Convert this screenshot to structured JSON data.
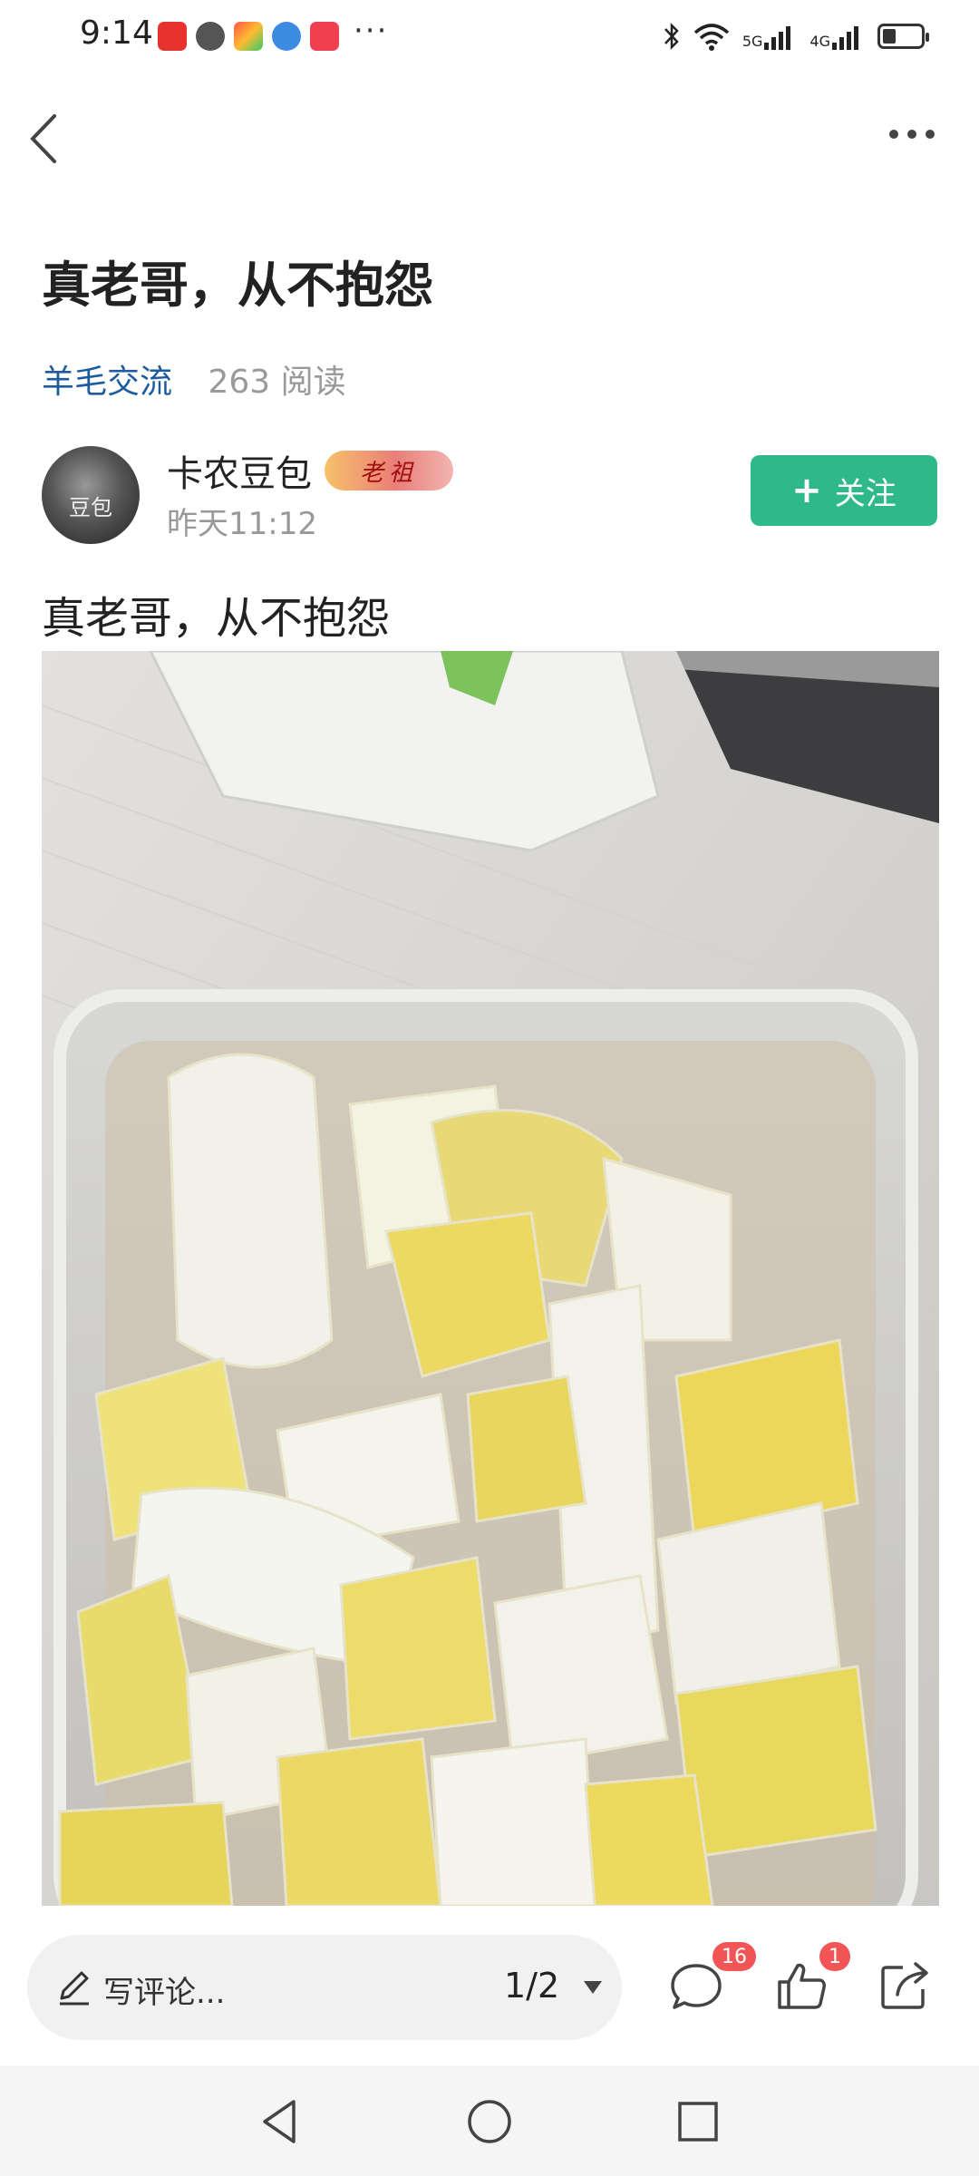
{
  "status_bar": {
    "time": "9:14",
    "app_icons": [
      "toutiao-icon",
      "message-icon",
      "store-icon",
      "browser-icon",
      "huawei-icon"
    ],
    "more": "···",
    "network": [
      "5G",
      "4G"
    ],
    "battery_level": 0.35,
    "icons": [
      "bluetooth-icon",
      "wifi-icon",
      "signal-icon",
      "battery-icon"
    ]
  },
  "nav": {
    "back_icon": "back-icon",
    "more_icon": "more-icon"
  },
  "post": {
    "title": "真老哥，从不抱怨",
    "circle": "羊毛交流",
    "read_count": "263 阅读",
    "author": {
      "name": "卡农豆包",
      "badge": "老祖",
      "time": "昨天11:12",
      "avatar_text": "豆包"
    },
    "follow_label": "关注",
    "body": "真老哥，从不抱怨"
  },
  "bottom_bar": {
    "comment_placeholder": "写评论...",
    "page_indicator": "1/2",
    "comment_count": "16",
    "like_count": "1"
  },
  "colors": {
    "accent": "#2fb98b",
    "link": "#1e5b9c",
    "badge_red": "#f25555"
  }
}
